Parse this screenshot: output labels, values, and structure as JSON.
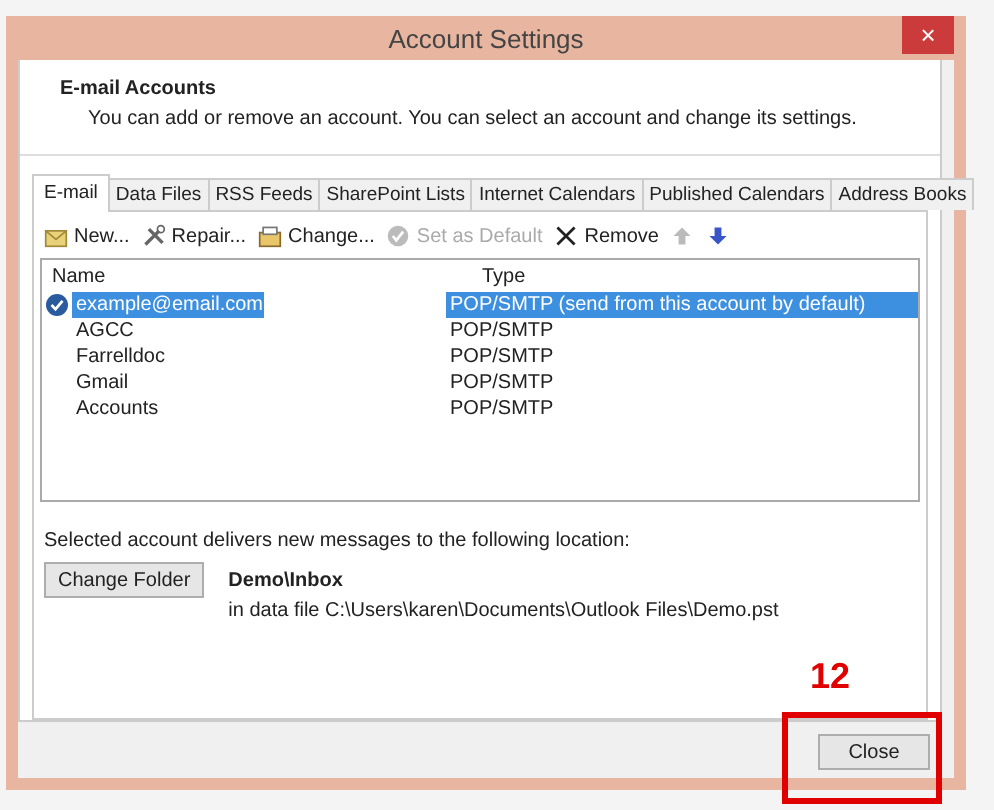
{
  "window": {
    "title": "Account Settings",
    "close_glyph": "×"
  },
  "header": {
    "title": "E-mail Accounts",
    "description": "You can add or remove an account. You can select an account and change its settings."
  },
  "tabs": [
    {
      "label": "E-mail",
      "selected": true
    },
    {
      "label": "Data Files",
      "selected": false
    },
    {
      "label": "RSS Feeds",
      "selected": false
    },
    {
      "label": "SharePoint Lists",
      "selected": false
    },
    {
      "label": "Internet Calendars",
      "selected": false
    },
    {
      "label": "Published Calendars",
      "selected": false
    },
    {
      "label": "Address Books",
      "selected": false
    }
  ],
  "toolbar": [
    {
      "kind": "new",
      "label": "New...",
      "disabled": false
    },
    {
      "kind": "repair",
      "label": "Repair...",
      "disabled": false
    },
    {
      "kind": "change",
      "label": "Change...",
      "disabled": false
    },
    {
      "kind": "default",
      "label": "Set as Default",
      "disabled": true
    },
    {
      "kind": "remove",
      "label": "Remove",
      "disabled": false
    },
    {
      "kind": "up",
      "disabled": true
    },
    {
      "kind": "down",
      "disabled": false
    }
  ],
  "table": {
    "columns": [
      "Name",
      "Type"
    ],
    "rows": [
      {
        "name": "example@email.com",
        "type": "POP/SMTP (send from this account by default)",
        "selected": true,
        "is_default": true
      },
      {
        "name": "AGCC",
        "type": "POP/SMTP",
        "selected": false,
        "is_default": false
      },
      {
        "name": "Farrelldoc",
        "type": "POP/SMTP",
        "selected": false,
        "is_default": false
      },
      {
        "name": "Gmail",
        "type": "POP/SMTP",
        "selected": false,
        "is_default": false
      },
      {
        "name": "Accounts",
        "type": "POP/SMTP",
        "selected": false,
        "is_default": false
      }
    ]
  },
  "delivery": {
    "caption": "Selected account delivers new messages to the following location:",
    "button": "Change Folder",
    "folder": "Demo\\Inbox",
    "path": "in data file C:\\Users\\karen\\Documents\\Outlook Files\\Demo.pst"
  },
  "footer": {
    "button": "Close"
  },
  "annotation": {
    "label": "12"
  }
}
